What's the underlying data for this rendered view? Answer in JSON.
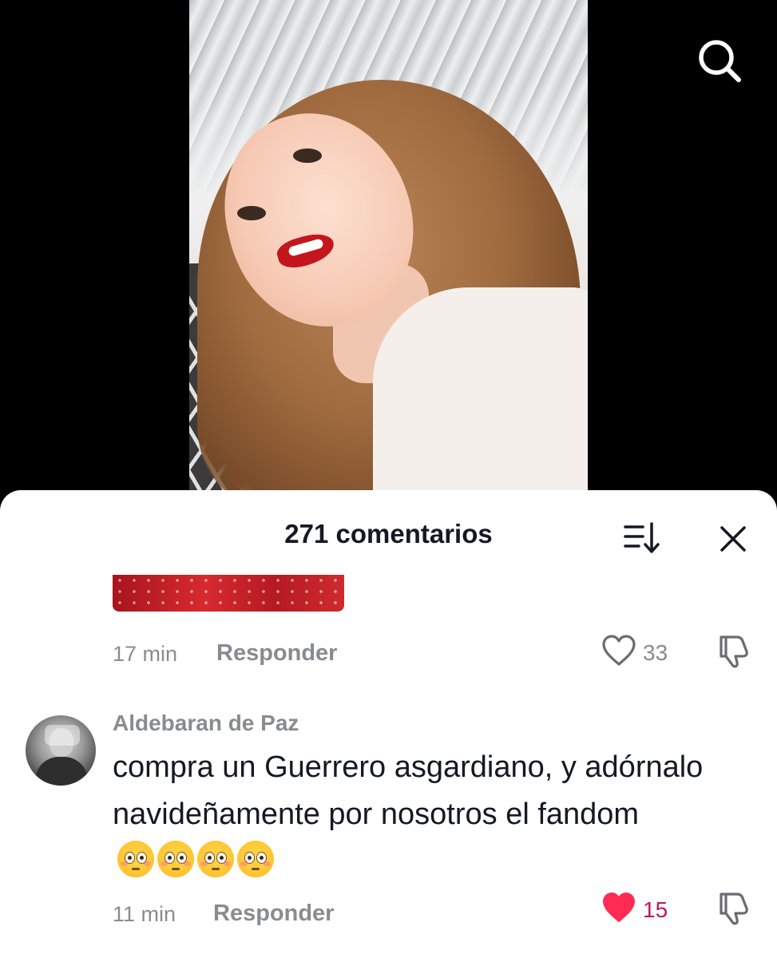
{
  "header": {
    "search_icon": "search-icon"
  },
  "comments_sheet": {
    "count_label": "271 comentarios",
    "sort_icon": "sort-icon",
    "close_icon": "close-icon"
  },
  "comments": [
    {
      "time": "17 min",
      "reply_label": "Responder",
      "likes": "33",
      "liked": false,
      "has_sticker": true
    },
    {
      "username": "Aldebaran de Paz",
      "text": "compra un Guerrero asgardiano, y adórnalo navideñamente por nosotros el fandom",
      "emojis": [
        "flushed-face",
        "flushed-face",
        "flushed-face",
        "flushed-face"
      ],
      "time": "11 min",
      "reply_label": "Responder",
      "likes": "15",
      "liked": true
    }
  ],
  "colors": {
    "text_primary": "#161823",
    "text_secondary": "#8a8b91",
    "like_active": "#fe2c55",
    "like_count_active": "#c2185b",
    "sheet_bg": "#ffffff",
    "video_bg": "#000000"
  }
}
